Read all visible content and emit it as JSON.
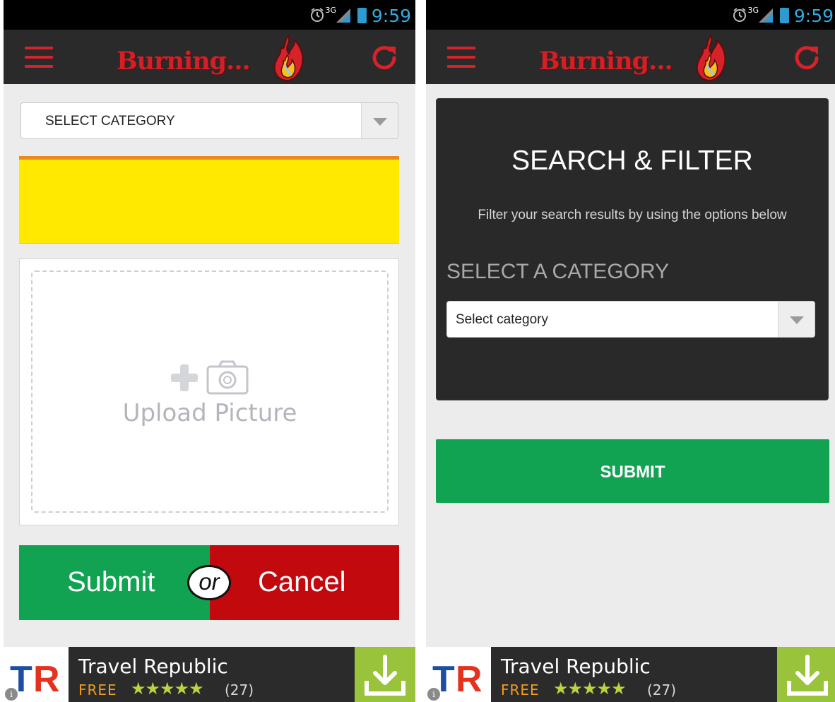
{
  "status_bar": {
    "network_label": "3G",
    "time": "9:59"
  },
  "app_bar": {
    "logo_text": "Burning..."
  },
  "left_screen": {
    "category_select": {
      "selected": "SELECT CATEGORY"
    },
    "upload": {
      "label": "Upload Picture"
    },
    "actions": {
      "submit_label": "Submit",
      "or_label": "or",
      "cancel_label": "Cancel"
    }
  },
  "right_screen": {
    "filter": {
      "title": "SEARCH & FILTER",
      "description": "Filter your search results by using the options below",
      "category_label": "SELECT A CATEGORY",
      "category_select": {
        "selected": "Select category"
      }
    },
    "submit_label": "SUBMIT"
  },
  "ad": {
    "logo_letters": [
      "T",
      "R"
    ],
    "app_name": "Travel Republic",
    "price": "FREE",
    "stars": "★★★★★",
    "rating_value": 4.5,
    "review_count": "(27)",
    "info_glyph": "i"
  },
  "colors": {
    "brand_red": "#d41f26",
    "green": "#12a352",
    "cancel_red": "#c1090e",
    "yellow": "#ffe900",
    "status_blue": "#33aadd",
    "ad_green": "#9ac33c"
  },
  "icons": [
    "menu-icon",
    "flame-icon",
    "refresh-icon",
    "alarm-icon",
    "signal-icon",
    "battery-icon",
    "dropdown-arrow-icon",
    "plus-icon",
    "camera-icon",
    "download-icon",
    "info-icon",
    "star-icon"
  ]
}
